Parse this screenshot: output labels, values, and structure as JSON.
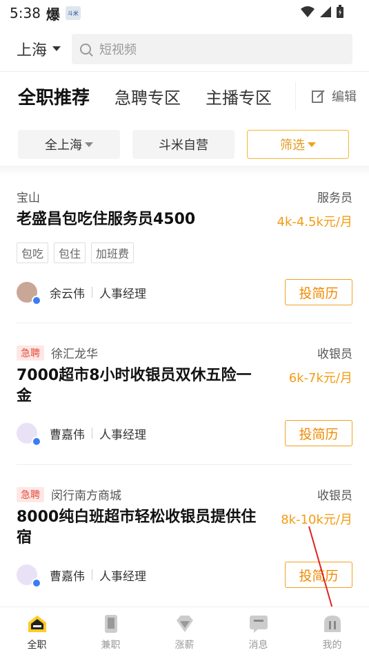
{
  "status": {
    "time": "5:38",
    "boom": "爆",
    "app_icon_label": "斗米"
  },
  "topbar": {
    "city": "上海",
    "search_placeholder": "短视频"
  },
  "tabs": [
    {
      "label": "全职推荐",
      "active": true
    },
    {
      "label": "急聘专区",
      "active": false
    },
    {
      "label": "主播专区",
      "active": false
    }
  ],
  "edit_label": "编辑",
  "filters": [
    {
      "label": "全上海"
    },
    {
      "label": "斗米自营"
    },
    {
      "label": "筛选"
    }
  ],
  "jobs": [
    {
      "location": "宝山",
      "urgent": "",
      "category": "服务员",
      "title": "老盛昌包吃住服务员4500",
      "salary": "4k-4.5k元/月",
      "tags": [
        "包吃",
        "包住",
        "加班费"
      ],
      "recruiter": "余云伟",
      "role": "人事经理",
      "apply": "投简历"
    },
    {
      "location": "徐汇龙华",
      "urgent": "急聘",
      "category": "收银员",
      "title": "7000超市8小时收银员双休五险一金",
      "salary": "6k-7k元/月",
      "recruiter": "曹嘉伟",
      "role": "人事经理",
      "apply": "投简历"
    },
    {
      "location": "闵行南方商城",
      "urgent": "急聘",
      "category": "收银员",
      "title": "8000纯白班超市轻松收银员提供住宿",
      "salary": "8k-10k元/月",
      "recruiter": "曹嘉伟",
      "role": "人事经理",
      "apply": "投简历"
    }
  ],
  "nav": [
    {
      "label": "全职",
      "icon": "fulltime-icon",
      "active": true
    },
    {
      "label": "兼职",
      "icon": "parttime-icon",
      "active": false
    },
    {
      "label": "涨薪",
      "icon": "diamond-icon",
      "active": false
    },
    {
      "label": "消息",
      "icon": "message-icon",
      "active": false
    },
    {
      "label": "我的",
      "icon": "profile-icon",
      "active": false
    }
  ],
  "colors": {
    "accent": "#ffcc22",
    "salary": "#f39c12",
    "apply": "#f08a00",
    "urgent": "#e64a3a"
  }
}
